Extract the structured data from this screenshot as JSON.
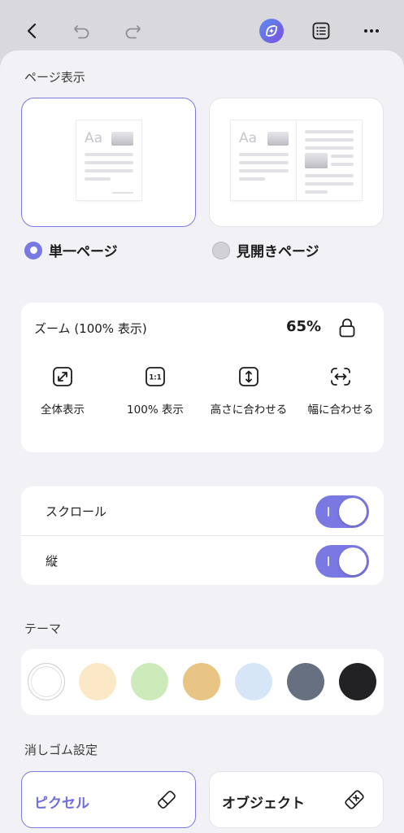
{
  "colors": {
    "accent": "#7a79e4",
    "sheet": "#f2f2f6",
    "card": "#ffffff"
  },
  "topbar": {
    "icons": [
      "back-chevron-icon",
      "undo-icon",
      "redo-icon",
      "ai-assistant-icon",
      "list-icon",
      "more-icon"
    ]
  },
  "page_display": {
    "title": "ページ表示",
    "single_label": "単一ページ",
    "spread_label": "見開きページ",
    "preview_text": "Aa",
    "selected": "single"
  },
  "zoom": {
    "title": "ズーム (100% 表示)",
    "value": "65%",
    "options": [
      {
        "label": "全体表示",
        "icon": "fit-all-icon"
      },
      {
        "label": "100% 表示",
        "icon": "actual-size-icon",
        "icon_text": "1:1"
      },
      {
        "label": "高さに合わせる",
        "icon": "fit-height-icon"
      },
      {
        "label": "幅に合わせる",
        "icon": "fit-width-icon"
      }
    ]
  },
  "toggles": [
    {
      "label": "スクロール",
      "on": true
    },
    {
      "label": "縦",
      "on": true
    }
  ],
  "theme": {
    "title": "テーマ",
    "swatches": [
      "#ffffff",
      "#fbe8c6",
      "#cdeaba",
      "#e8c585",
      "#d6e6f6",
      "#667080",
      "#222225"
    ],
    "selected_index": 0
  },
  "eraser": {
    "title": "消しゴム設定",
    "pixel_label": "ピクセル",
    "object_label": "オブジェクト",
    "selected": "pixel"
  }
}
